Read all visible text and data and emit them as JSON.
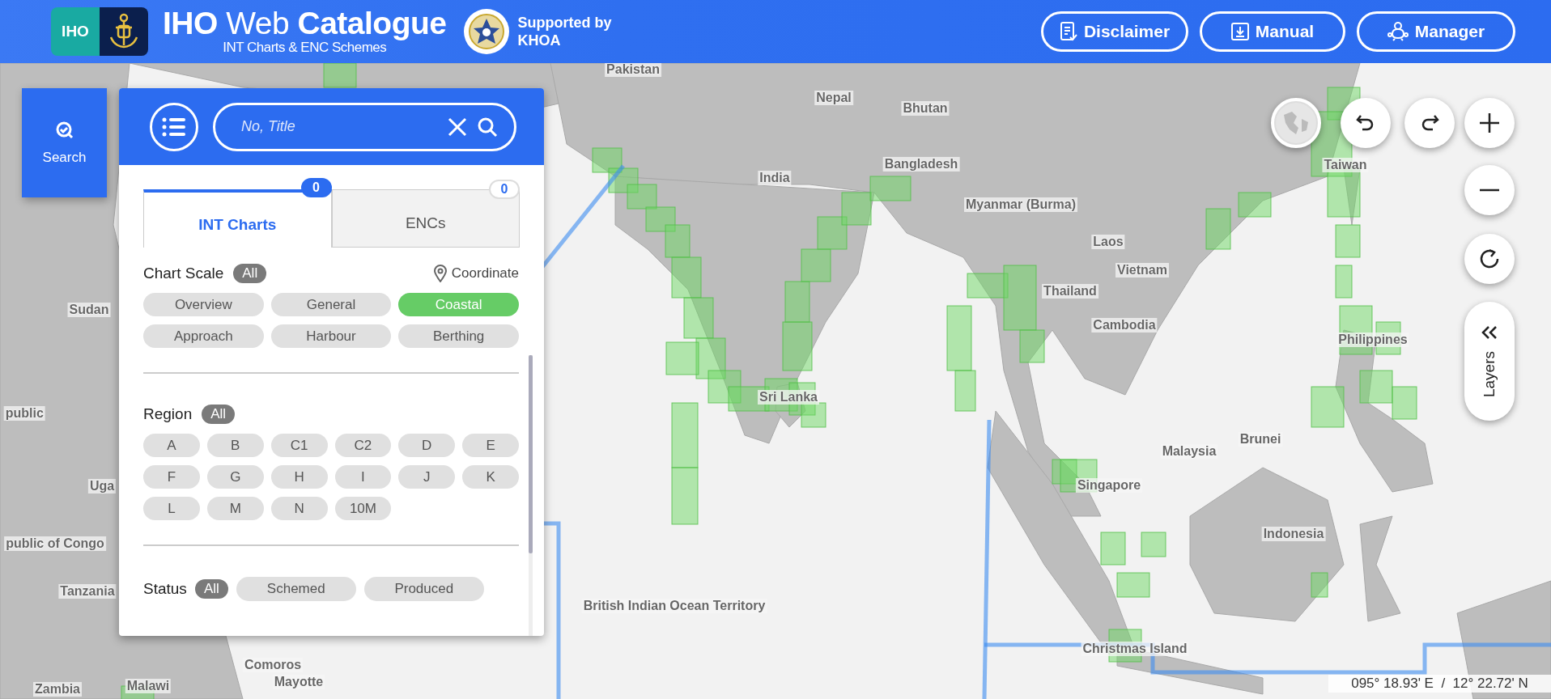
{
  "header": {
    "logo_text": "IHO",
    "title": "**IHO** Web **Catalogue**",
    "subtitle": "INT Charts & ENC Schemes",
    "supported_by": "Supported by",
    "supporter": "KHOA",
    "buttons": [
      {
        "label": "Disclaimer",
        "kind": "disclaimer"
      },
      {
        "label": "Manual",
        "kind": "manual"
      },
      {
        "label": "Manager",
        "kind": "manager"
      }
    ]
  },
  "side_tab": {
    "label": "Search",
    "selected": true
  },
  "panel": {
    "search": {
      "placeholder": "No, Title"
    },
    "tabs": [
      {
        "label": "INT Charts",
        "count": "0",
        "selected": true
      },
      {
        "label": "ENCs",
        "count": "0",
        "selected": false
      }
    ],
    "filters": [
      {
        "title": "Chart Scale",
        "all_label": "All",
        "link": "Coordinate",
        "options": [
          {
            "label": "Overview",
            "selected": false
          },
          {
            "label": "General",
            "selected": false
          },
          {
            "label": "Coastal",
            "selected": true
          },
          {
            "label": "Approach",
            "selected": false
          },
          {
            "label": "Harbour",
            "selected": false
          },
          {
            "label": "Berthing",
            "selected": false
          }
        ]
      },
      {
        "title": "Region",
        "all_label": "All",
        "options": [
          {
            "label": "A",
            "selected": false
          },
          {
            "label": "B",
            "selected": false
          },
          {
            "label": "C1",
            "selected": false
          },
          {
            "label": "C2",
            "selected": false
          },
          {
            "label": "D",
            "selected": false
          },
          {
            "label": "E",
            "selected": false
          },
          {
            "label": "F",
            "selected": false
          },
          {
            "label": "G",
            "selected": false
          },
          {
            "label": "H",
            "selected": false
          },
          {
            "label": "I",
            "selected": false
          },
          {
            "label": "J",
            "selected": false
          },
          {
            "label": "K",
            "selected": false
          },
          {
            "label": "L",
            "selected": false
          },
          {
            "label": "M",
            "selected": false
          },
          {
            "label": "N",
            "selected": false
          },
          {
            "label": "10M",
            "selected": false
          }
        ]
      },
      {
        "title": "Status",
        "all_label": "All",
        "options": [
          {
            "label": "Schemed",
            "selected": false
          },
          {
            "label": "Produced",
            "selected": false
          }
        ]
      }
    ]
  },
  "map": {
    "labels": [
      "Pakistan",
      "Nepal",
      "Bhutan",
      "India",
      "Bangladesh",
      "Myanmar (Burma)",
      "Laos",
      "Vietnam",
      "Thailand",
      "Cambodia",
      "Taiwan",
      "Philippines",
      "Sudan",
      "public",
      "Uga",
      "public of Congo",
      "Tanzania",
      "Zambia",
      "Malawi",
      "Comoros",
      "Mayotte",
      "British Indian Ocean Territory",
      "Sri Lanka",
      "Malaysia",
      "Brunei",
      "Singapore",
      "Indonesia",
      "Christmas Island"
    ],
    "layers_label": "Layers",
    "coordinate": "095° 18.93' E  /  12° 22.72' N"
  }
}
